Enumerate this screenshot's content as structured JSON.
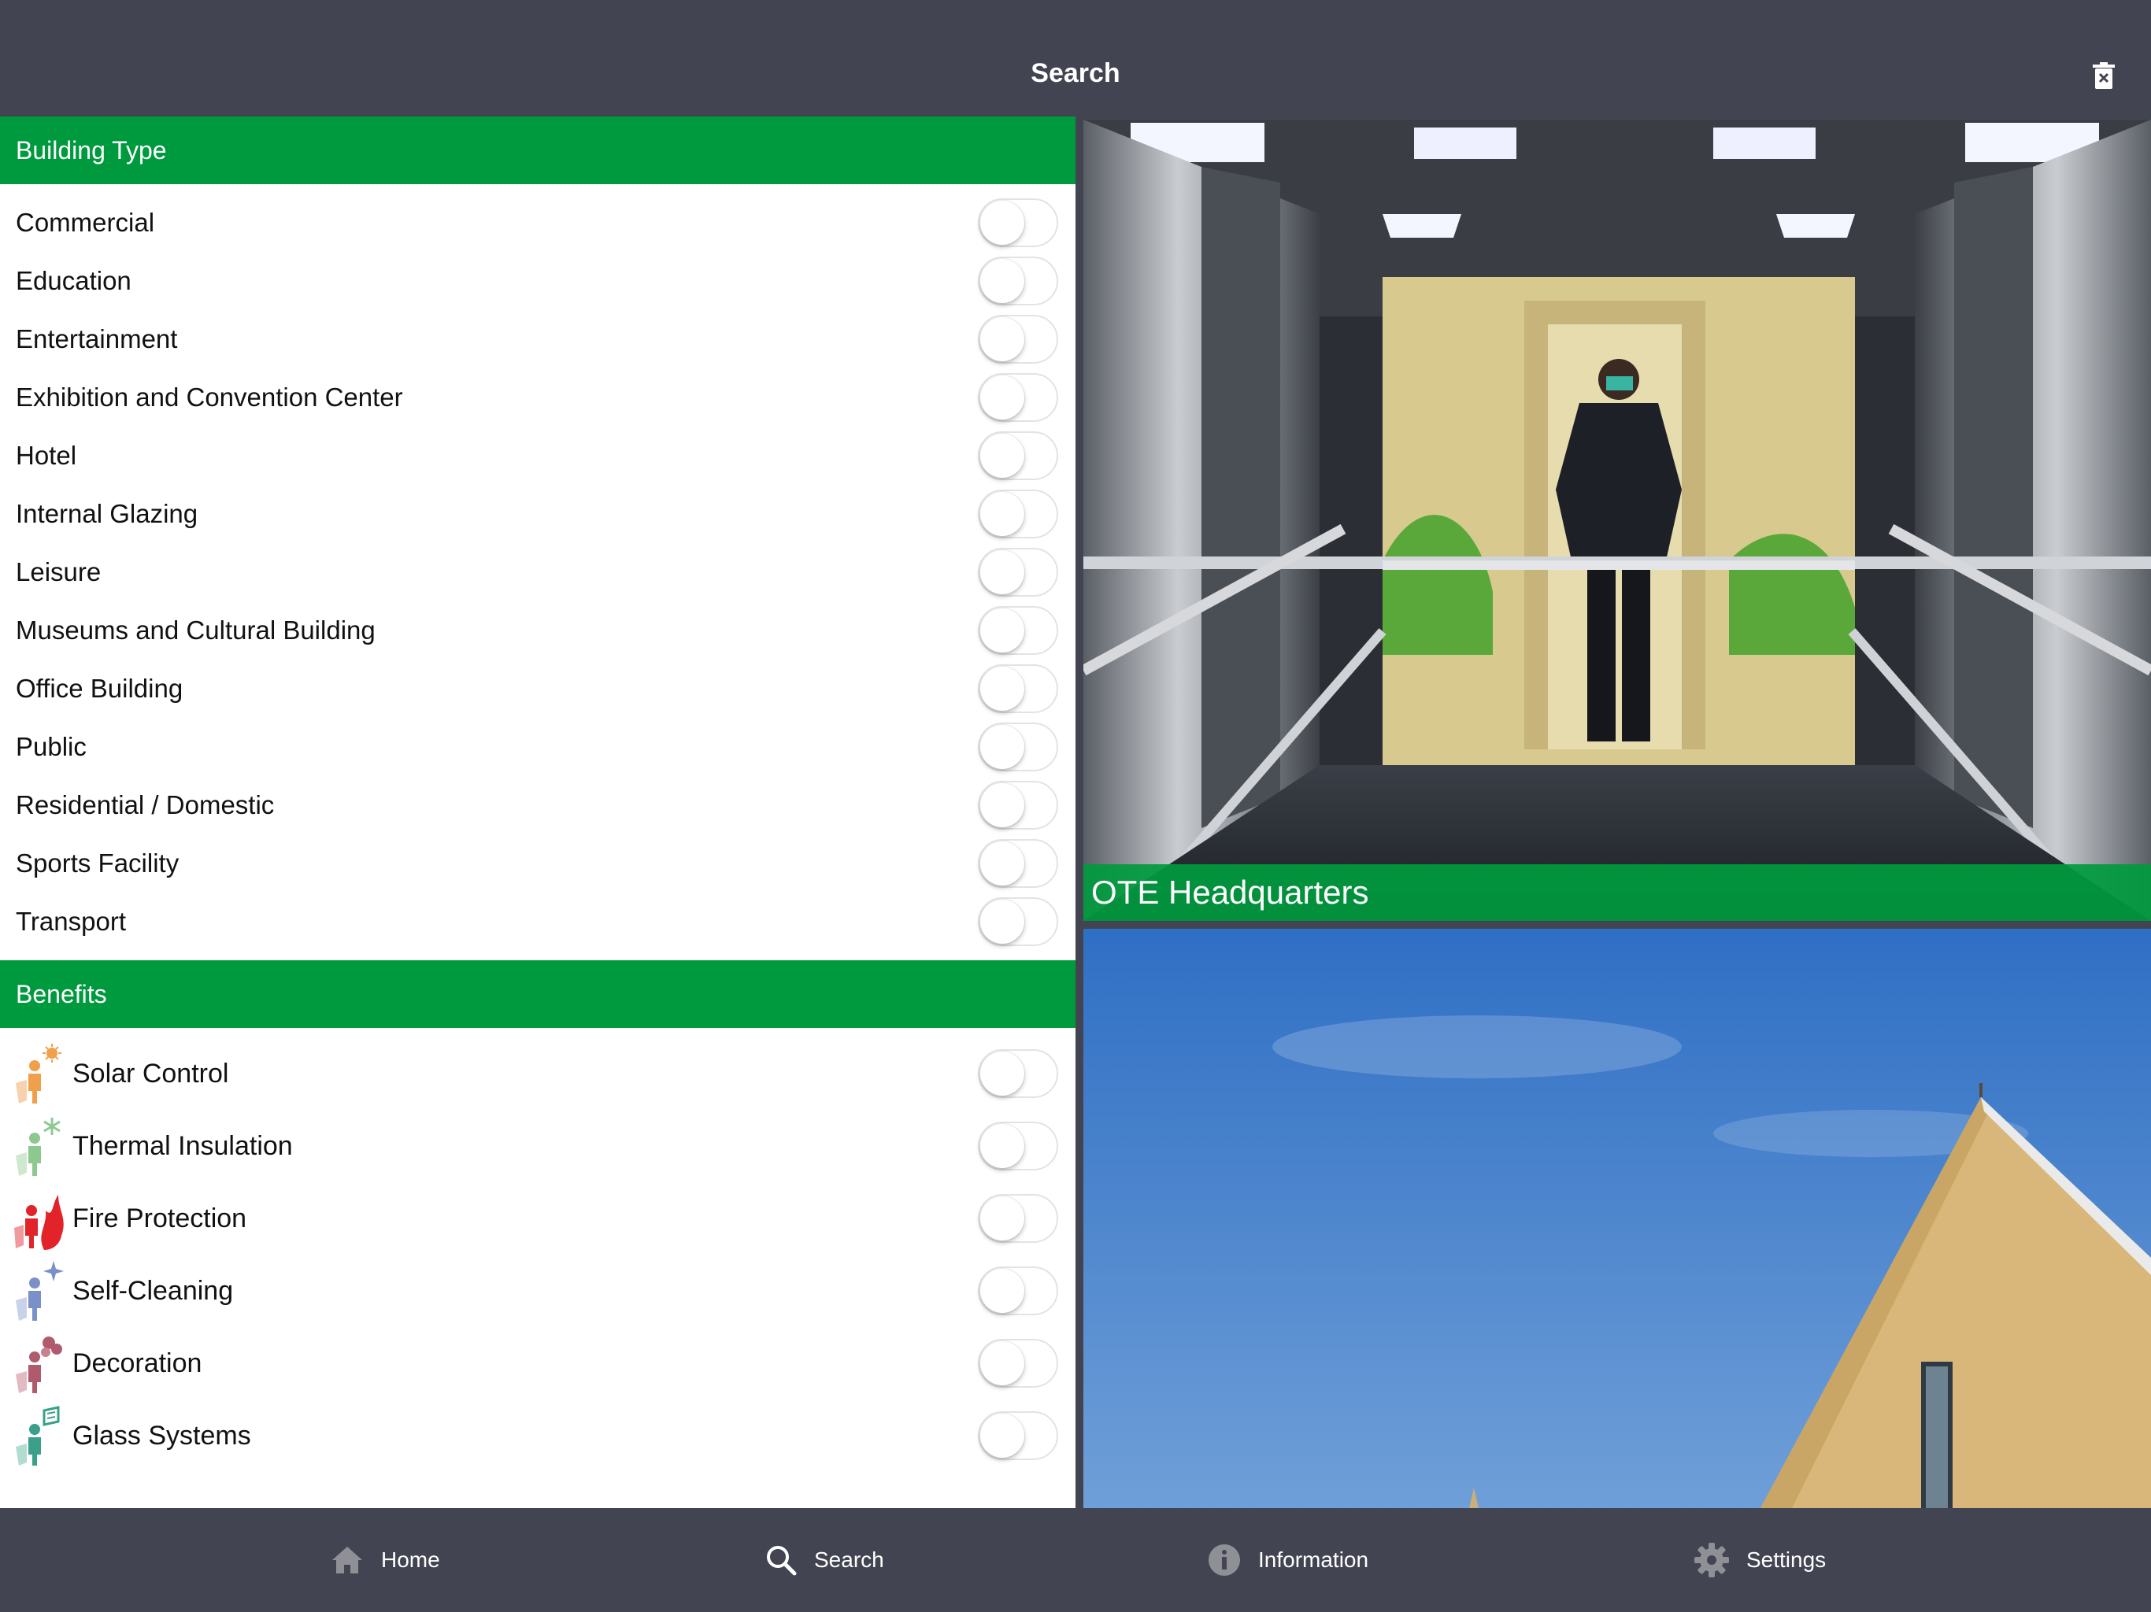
{
  "header": {
    "title": "Search",
    "clear_icon": "trash-icon"
  },
  "building_type": {
    "title": "Building Type",
    "items": [
      {
        "label": "Commercial"
      },
      {
        "label": "Education"
      },
      {
        "label": "Entertainment"
      },
      {
        "label": "Exhibition and Convention Center"
      },
      {
        "label": "Hotel"
      },
      {
        "label": "Internal Glazing"
      },
      {
        "label": "Leisure"
      },
      {
        "label": "Museums and Cultural Building"
      },
      {
        "label": "Office Building"
      },
      {
        "label": "Public"
      },
      {
        "label": "Residential / Domestic"
      },
      {
        "label": "Sports Facility"
      },
      {
        "label": "Transport"
      }
    ]
  },
  "benefits": {
    "title": "Benefits",
    "items": [
      {
        "label": "Solar Control",
        "icon": "solar-control-icon",
        "color": "#f0a04b"
      },
      {
        "label": "Thermal Insulation",
        "icon": "thermal-insulation-icon",
        "color": "#8dc98f"
      },
      {
        "label": "Fire Protection",
        "icon": "fire-protection-icon",
        "color": "#e2242a"
      },
      {
        "label": "Self-Cleaning",
        "icon": "self-cleaning-icon",
        "color": "#7b8fc9"
      },
      {
        "label": "Decoration",
        "icon": "decoration-icon",
        "color": "#b05a6e"
      },
      {
        "label": "Glass Systems",
        "icon": "glass-systems-icon",
        "color": "#3aa08a"
      }
    ]
  },
  "results": [
    {
      "caption": "OTE Headquarters"
    }
  ],
  "tabs": [
    {
      "label": "Home",
      "icon": "home-icon"
    },
    {
      "label": "Search",
      "icon": "search-icon"
    },
    {
      "label": "Information",
      "icon": "info-icon"
    },
    {
      "label": "Settings",
      "icon": "gear-icon"
    }
  ],
  "colors": {
    "bar": "#424551",
    "accent": "#009a3e"
  }
}
